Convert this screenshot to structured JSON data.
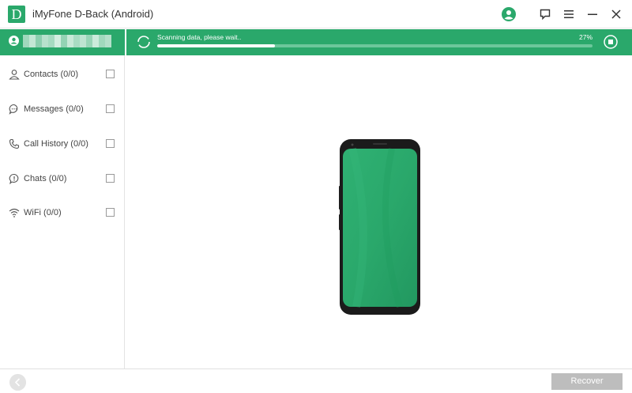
{
  "window": {
    "title": "iMyFone D-Back (Android)",
    "logo_letter": "D"
  },
  "colors": {
    "brand": "#2aa86b",
    "progress_track": "#6cc79b",
    "disabled_button": "#bdbdbd"
  },
  "titlebar_icons": [
    "account-icon",
    "feedback-icon",
    "menu-icon",
    "minimize-icon",
    "close-icon"
  ],
  "scan": {
    "status": "Scanning data, please wait..",
    "percent_label": "27%",
    "progress": 0.27
  },
  "sidebar": {
    "items": [
      {
        "label": "Contacts (0/0)",
        "icon": "contacts-icon"
      },
      {
        "label": "Messages (0/0)",
        "icon": "messages-icon"
      },
      {
        "label": "Call History (0/0)",
        "icon": "phone-icon"
      },
      {
        "label": "Chats (0/0)",
        "icon": "chat-icon"
      },
      {
        "label": "WiFi (0/0)",
        "icon": "wifi-icon"
      }
    ]
  },
  "footer": {
    "recover_label": "Recover"
  }
}
